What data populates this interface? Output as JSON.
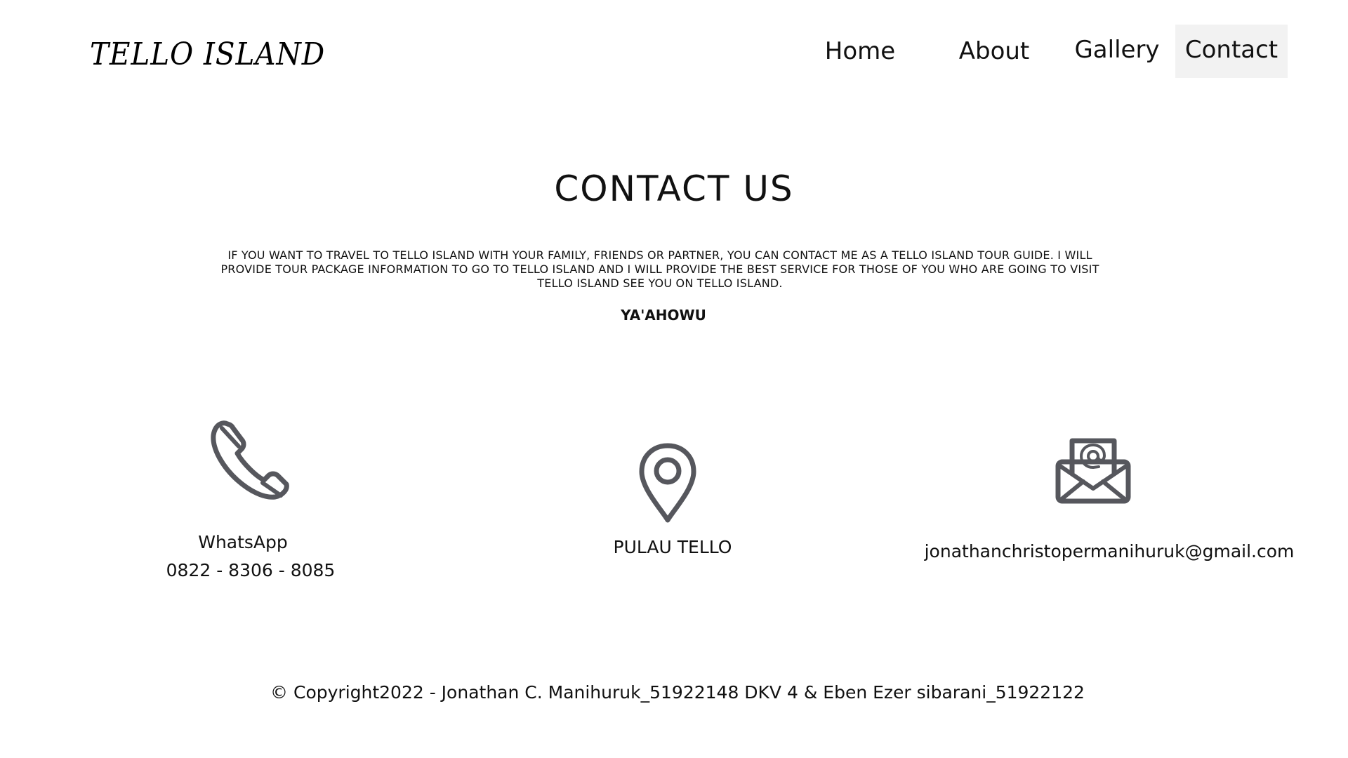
{
  "header": {
    "logo_text": "TELLO ISLAND",
    "nav": [
      {
        "label": "Home",
        "active": false
      },
      {
        "label": "About",
        "active": false
      },
      {
        "label": "Gallery",
        "active": false
      },
      {
        "label": "Contact",
        "active": true
      }
    ]
  },
  "main": {
    "title": "CONTACT US",
    "intro": "IF YOU WANT TO TRAVEL TO TELLO ISLAND WITH YOUR FAMILY, FRIENDS OR PARTNER, YOU CAN CONTACT ME AS A TELLO ISLAND TOUR GUIDE. I WILL PROVIDE TOUR PACKAGE INFORMATION TO GO TO TELLO ISLAND AND I WILL PROVIDE THE BEST SERVICE FOR THOSE OF YOU WHO ARE GOING TO VISIT TELLO ISLAND SEE YOU ON TELLO ISLAND.",
    "signoff": "YA'AHOWU"
  },
  "contacts": {
    "whatsapp": {
      "icon": "phone-icon",
      "label": "WhatsApp",
      "number": "0822 - 8306 - 8085"
    },
    "location": {
      "icon": "location-pin-icon",
      "label": "PULAU TELLO"
    },
    "email": {
      "icon": "email-envelope-icon",
      "address": "jonathanchristopermanihuruk@gmail.com"
    }
  },
  "footer": {
    "copyright": "© Copyright2022 - Jonathan C. Manihuruk_51922148 DKV 4 & Eben Ezer sibarani_51922122"
  },
  "colors": {
    "icon": "#56575d",
    "active_nav_bg": "#f2f2f2",
    "text": "#111111",
    "background": "#ffffff"
  }
}
